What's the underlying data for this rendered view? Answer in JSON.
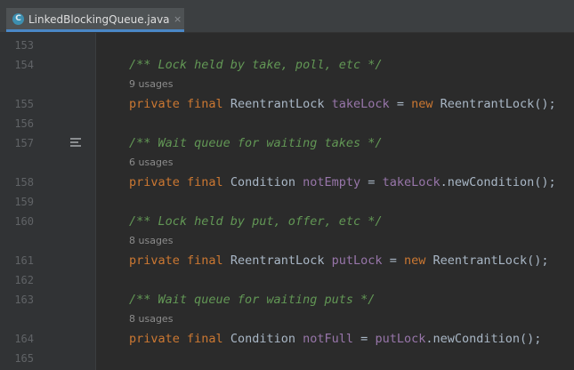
{
  "tab": {
    "title": "LinkedBlockingQueue.java",
    "icon": "C",
    "close": "×"
  },
  "lines": {
    "l153": {
      "num": "153"
    },
    "l154": {
      "num": "154",
      "comment": "/** Lock held by take, poll, etc */"
    },
    "u154": {
      "usage": "9 usages"
    },
    "l155": {
      "num": "155",
      "kw1": "private",
      "kw2": "final",
      "type": "ReentrantLock",
      "field": "takeLock",
      "eq": "=",
      "new": "new",
      "rhs": "ReentrantLock();"
    },
    "l156": {
      "num": "156"
    },
    "l157": {
      "num": "157",
      "comment": "/** Wait queue for waiting takes */"
    },
    "u157": {
      "usage": "6 usages"
    },
    "l158": {
      "num": "158",
      "kw1": "private",
      "kw2": "final",
      "type": "Condition",
      "field": "notEmpty",
      "eq": "=",
      "ref": "takeLock",
      "rhs": ".newCondition();"
    },
    "l159": {
      "num": "159"
    },
    "l160": {
      "num": "160",
      "comment": "/** Lock held by put, offer, etc */"
    },
    "u160": {
      "usage": "8 usages"
    },
    "l161": {
      "num": "161",
      "kw1": "private",
      "kw2": "final",
      "type": "ReentrantLock",
      "field": "putLock",
      "eq": "=",
      "new": "new",
      "rhs": "ReentrantLock();"
    },
    "l162": {
      "num": "162"
    },
    "l163": {
      "num": "163",
      "comment": "/** Wait queue for waiting puts */"
    },
    "u163": {
      "usage": "8 usages"
    },
    "l164": {
      "num": "164",
      "kw1": "private",
      "kw2": "final",
      "type": "Condition",
      "field": "notFull",
      "eq": "=",
      "ref": "putLock",
      "rhs": ".newCondition();"
    },
    "l165": {
      "num": "165"
    }
  },
  "colors": {
    "keyword": "#cc7832",
    "field": "#9876aa",
    "doc_comment": "#629755",
    "text": "#a9b7c6",
    "background": "#2b2b2b",
    "gutter": "#313335",
    "line_number": "#606366"
  },
  "icons": {
    "tab": "java-class-icon",
    "gutter_157": "doc-render-toggle-icon"
  }
}
